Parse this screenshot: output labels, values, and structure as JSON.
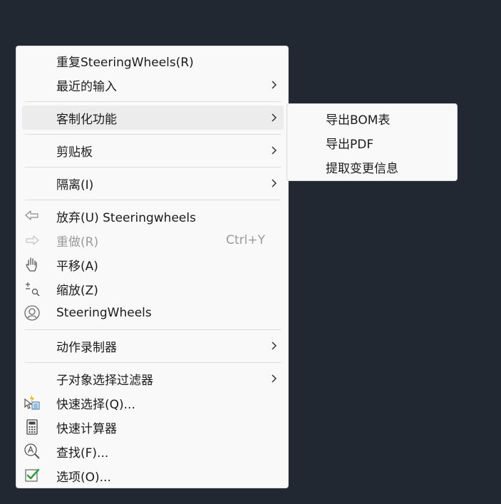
{
  "menu": {
    "items": [
      {
        "label": "重复SteeringWheels(R)"
      },
      {
        "label": "最近的输入",
        "icon": "chevron-right-icon"
      },
      {
        "label": "客制化功能",
        "icon": "chevron-right-icon"
      },
      {
        "label": "剪贴板",
        "icon": "chevron-right-icon"
      },
      {
        "label": "隔离(I)",
        "icon": "chevron-right-icon"
      },
      {
        "label": "放弃(U) Steeringwheels",
        "icon": "undo-icon"
      },
      {
        "label": "重做(R)",
        "shortcut": "Ctrl+Y",
        "icon": "redo-icon"
      },
      {
        "label": "平移(A)",
        "icon": "pan-hand-icon"
      },
      {
        "label": "缩放(Z)",
        "icon": "zoom-icon"
      },
      {
        "label": "SteeringWheels",
        "icon": "steering-wheel-icon"
      },
      {
        "label": "动作录制器",
        "icon": "chevron-right-icon"
      },
      {
        "label": "子对象选择过滤器",
        "icon": "chevron-right-icon"
      },
      {
        "label": "快速选择(Q)...",
        "icon": "quick-select-icon"
      },
      {
        "label": "快速计算器",
        "icon": "calculator-icon"
      },
      {
        "label": "查找(F)...",
        "icon": "find-icon"
      },
      {
        "label": "选项(O)...",
        "icon": "checkmark-icon"
      }
    ]
  },
  "submenu": {
    "items": [
      {
        "label": "导出BOM表"
      },
      {
        "label": "导出PDF"
      },
      {
        "label": "提取变更信息"
      }
    ]
  },
  "colors": {
    "background": "#222831",
    "menu_bg": "#f9f9f9",
    "hover_bg": "#ececec",
    "disabled_text": "#9a9a9a",
    "check_green": "#2e9d3a"
  }
}
